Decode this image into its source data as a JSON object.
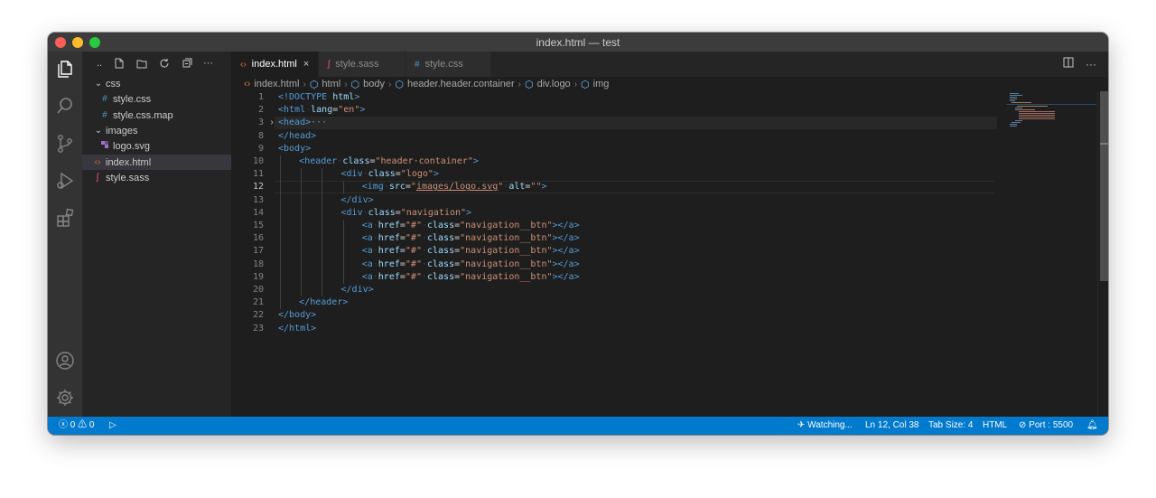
{
  "window": {
    "title": "index.html — test",
    "traffic_lights": {
      "close": "#ff5f57",
      "minimize": "#febc2e",
      "zoom": "#28c840"
    }
  },
  "activity_bar": {
    "items": [
      {
        "icon": "files-icon",
        "active": true
      },
      {
        "icon": "search-icon"
      },
      {
        "icon": "source-control-icon"
      },
      {
        "icon": "run-debug-icon"
      },
      {
        "icon": "extensions-icon"
      }
    ],
    "bottom": [
      {
        "icon": "account-icon"
      },
      {
        "icon": "gear-icon"
      }
    ]
  },
  "sidebar": {
    "toolbar": {
      "dots_label": "..",
      "more_label": "···"
    },
    "tree": [
      {
        "label": "css",
        "type": "folder",
        "expanded": true,
        "icon": "chevron-down-icon"
      },
      {
        "label": "style.css",
        "type": "file",
        "icon": "#",
        "icon_color": "#519aba"
      },
      {
        "label": "style.css.map",
        "type": "file",
        "icon": "#",
        "icon_color": "#519aba"
      },
      {
        "label": "images",
        "type": "folder",
        "expanded": true,
        "icon": "chevron-down-icon"
      },
      {
        "label": "logo.svg",
        "type": "file",
        "icon": "svg-file-icon",
        "icon_color": "#a074c4"
      },
      {
        "label": "index.html",
        "type": "file",
        "icon": "<>",
        "icon_color": "#e37933",
        "selected": true
      },
      {
        "label": "style.sass",
        "type": "file",
        "icon": "sass-icon",
        "icon_color": "#f55385"
      }
    ]
  },
  "tabs": [
    {
      "label": "index.html",
      "icon": "<>",
      "icon_color": "#e37933",
      "active": true,
      "close": "×"
    },
    {
      "label": "style.sass",
      "icon": "sass-icon",
      "icon_color": "#f55385"
    },
    {
      "label": "style.css",
      "icon": "#",
      "icon_color": "#519aba"
    }
  ],
  "breadcrumb": [
    "index.html",
    "html",
    "body",
    "header.header.container",
    "div.logo",
    "img"
  ],
  "editor": {
    "line_numbers": [
      "1",
      "2",
      "3",
      "8",
      "9",
      "10",
      "11",
      "12",
      "13",
      "14",
      "15",
      "16",
      "17",
      "18",
      "19",
      "20",
      "21",
      "22",
      "23"
    ],
    "active_line": "12",
    "lines": [
      {
        "n": "1",
        "indent": 0,
        "tokens": [
          [
            "t-tag",
            "<!DOCTYPE "
          ],
          [
            "t-attr",
            "html"
          ],
          [
            "t-tag",
            ">"
          ]
        ]
      },
      {
        "n": "2",
        "indent": 0,
        "tokens": [
          [
            "t-tag",
            "<html"
          ],
          [
            "t-ws",
            "·"
          ],
          [
            "t-attr",
            "lang"
          ],
          [
            "t-txt",
            "="
          ],
          [
            "t-str",
            "\"en\""
          ],
          [
            "t-tag",
            ">"
          ]
        ]
      },
      {
        "n": "3",
        "indent": 0,
        "fold": "›",
        "highlight": true,
        "tokens": [
          [
            "t-tag",
            "<head>"
          ],
          [
            "t-dots",
            "···"
          ]
        ]
      },
      {
        "n": "8",
        "indent": 0,
        "tokens": [
          [
            "t-tag",
            "</head>"
          ]
        ]
      },
      {
        "n": "9",
        "indent": 0,
        "tokens": [
          [
            "t-tag",
            "<body>"
          ]
        ]
      },
      {
        "n": "10",
        "indent": 1,
        "tokens": [
          [
            "t-tag",
            "<header"
          ],
          [
            "t-ws",
            "·"
          ],
          [
            "t-attr",
            "class"
          ],
          [
            "t-txt",
            "="
          ],
          [
            "t-str",
            "\"header·container\""
          ],
          [
            "t-tag",
            ">"
          ]
        ]
      },
      {
        "n": "11",
        "indent": 3,
        "tokens": [
          [
            "t-tag",
            "<div"
          ],
          [
            "t-ws",
            "·"
          ],
          [
            "t-attr",
            "class"
          ],
          [
            "t-txt",
            "="
          ],
          [
            "t-str",
            "\"logo\""
          ],
          [
            "t-tag",
            ">"
          ]
        ]
      },
      {
        "n": "12",
        "indent": 4,
        "current": true,
        "tokens": [
          [
            "t-tag",
            "<img"
          ],
          [
            "t-ws",
            "·"
          ],
          [
            "t-attr",
            "src"
          ],
          [
            "t-txt",
            "="
          ],
          [
            "t-str",
            "\""
          ],
          [
            "t-str t-u",
            "images/logo.svg"
          ],
          [
            "t-str",
            "\""
          ],
          [
            "t-ws",
            "·"
          ],
          [
            "t-attr",
            "alt"
          ],
          [
            "t-txt",
            "="
          ],
          [
            "t-str",
            "\"\""
          ],
          [
            "t-tag",
            ">"
          ]
        ]
      },
      {
        "n": "13",
        "indent": 3,
        "tokens": [
          [
            "t-tag",
            "</div>"
          ]
        ]
      },
      {
        "n": "14",
        "indent": 3,
        "tokens": [
          [
            "t-tag",
            "<div"
          ],
          [
            "t-ws",
            "·"
          ],
          [
            "t-attr",
            "class"
          ],
          [
            "t-txt",
            "="
          ],
          [
            "t-str",
            "\"navigation\""
          ],
          [
            "t-tag",
            ">"
          ]
        ]
      },
      {
        "n": "15",
        "indent": 4,
        "tokens": [
          [
            "t-tag",
            "<a"
          ],
          [
            "t-ws",
            "·"
          ],
          [
            "t-attr",
            "href"
          ],
          [
            "t-txt",
            "="
          ],
          [
            "t-str",
            "\"#\""
          ],
          [
            "t-ws",
            "·"
          ],
          [
            "t-attr",
            "class"
          ],
          [
            "t-txt",
            "="
          ],
          [
            "t-str",
            "\"navigation__btn\""
          ],
          [
            "t-tag",
            "></a>"
          ]
        ]
      },
      {
        "n": "16",
        "indent": 4,
        "tokens": [
          [
            "t-tag",
            "<a"
          ],
          [
            "t-ws",
            "·"
          ],
          [
            "t-attr",
            "href"
          ],
          [
            "t-txt",
            "="
          ],
          [
            "t-str",
            "\"#\""
          ],
          [
            "t-ws",
            "·"
          ],
          [
            "t-attr",
            "class"
          ],
          [
            "t-txt",
            "="
          ],
          [
            "t-str",
            "\"navigation__btn\""
          ],
          [
            "t-tag",
            "></a>"
          ]
        ]
      },
      {
        "n": "17",
        "indent": 4,
        "tokens": [
          [
            "t-tag",
            "<a"
          ],
          [
            "t-ws",
            "·"
          ],
          [
            "t-attr",
            "href"
          ],
          [
            "t-txt",
            "="
          ],
          [
            "t-str",
            "\"#\""
          ],
          [
            "t-ws",
            "·"
          ],
          [
            "t-attr",
            "class"
          ],
          [
            "t-txt",
            "="
          ],
          [
            "t-str",
            "\"navigation__btn\""
          ],
          [
            "t-tag",
            "></a>"
          ]
        ]
      },
      {
        "n": "18",
        "indent": 4,
        "tokens": [
          [
            "t-tag",
            "<a"
          ],
          [
            "t-ws",
            "·"
          ],
          [
            "t-attr",
            "href"
          ],
          [
            "t-txt",
            "="
          ],
          [
            "t-str",
            "\"#\""
          ],
          [
            "t-ws",
            "·"
          ],
          [
            "t-attr",
            "class"
          ],
          [
            "t-txt",
            "="
          ],
          [
            "t-str",
            "\"navigation__btn\""
          ],
          [
            "t-tag",
            "></a>"
          ]
        ]
      },
      {
        "n": "19",
        "indent": 4,
        "tokens": [
          [
            "t-tag",
            "<a"
          ],
          [
            "t-ws",
            "·"
          ],
          [
            "t-attr",
            "href"
          ],
          [
            "t-txt",
            "="
          ],
          [
            "t-str",
            "\"#\""
          ],
          [
            "t-ws",
            "·"
          ],
          [
            "t-attr",
            "class"
          ],
          [
            "t-txt",
            "="
          ],
          [
            "t-str",
            "\"navigation__btn\""
          ],
          [
            "t-tag",
            "></a>"
          ]
        ]
      },
      {
        "n": "20",
        "indent": 3,
        "tokens": [
          [
            "t-tag",
            "</div>"
          ]
        ]
      },
      {
        "n": "21",
        "indent": 1,
        "tokens": [
          [
            "t-tag",
            "</header>"
          ]
        ]
      },
      {
        "n": "22",
        "indent": 0,
        "tokens": [
          [
            "t-tag",
            "</body>"
          ]
        ]
      },
      {
        "n": "23",
        "indent": 0,
        "tokens": [
          [
            "t-tag",
            "</html>"
          ]
        ]
      }
    ]
  },
  "statusbar": {
    "errors": "0",
    "warnings": "0",
    "watching": "Watching...",
    "position": "Ln 12, Col 38",
    "tab_size": "Tab Size: 4",
    "language": "HTML",
    "port": "Port : 5500",
    "background": "#007acc"
  }
}
